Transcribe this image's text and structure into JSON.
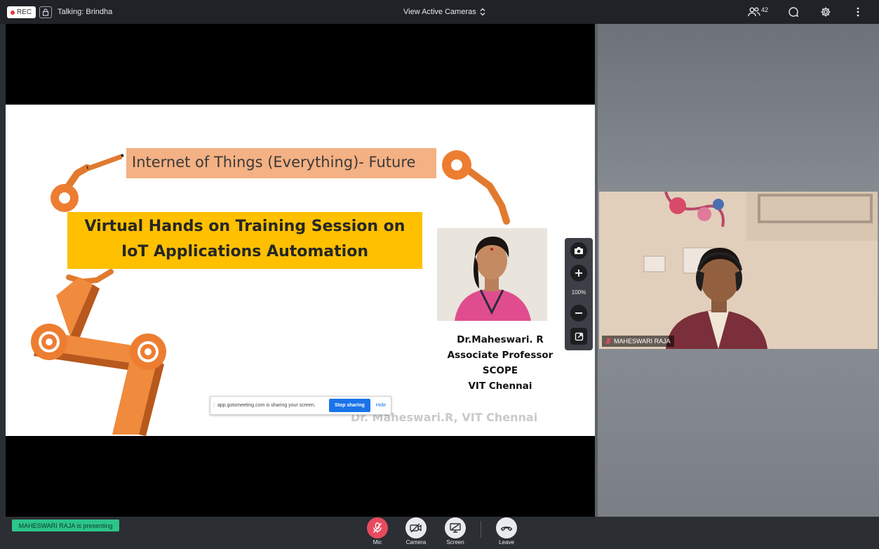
{
  "topbar": {
    "rec_label": "REC",
    "talking": "Talking: Brindha",
    "view_cameras": "View Active Cameras",
    "participant_count": "42"
  },
  "slide": {
    "title": "Internet of Things (Everything)- Future",
    "banner_line1": "Virtual Hands on Training Session on",
    "banner_line2": "IoT Applications Automation",
    "presenter_name": "Dr.Maheswari. R",
    "presenter_role": "Associate Professor",
    "presenter_school": "SCOPE",
    "presenter_college": "VIT Chennai",
    "watermark": "Dr. Maheswari.R, VIT Chennai"
  },
  "share_bar": {
    "message": "app.gotomeeting.com is sharing your screen.",
    "stop_label": "Stop sharing",
    "hide_label": "Hide"
  },
  "zoom": {
    "level": "100%"
  },
  "camera": {
    "name": "MAHESWARI RAJA"
  },
  "bottombar": {
    "presenting": "MAHESWARI RAJA is presenting",
    "mic_label": "Mic",
    "camera_label": "Camera",
    "screen_label": "Screen",
    "leave_label": "Leave"
  },
  "colors": {
    "accent_orange": "#ed7d31",
    "mic_muted": "#e84a5f",
    "presenting_badge": "#2cc48a",
    "stop_sharing": "#1a73e8",
    "slide_banner": "#ffc000",
    "slide_title_box": "#f4b183"
  }
}
